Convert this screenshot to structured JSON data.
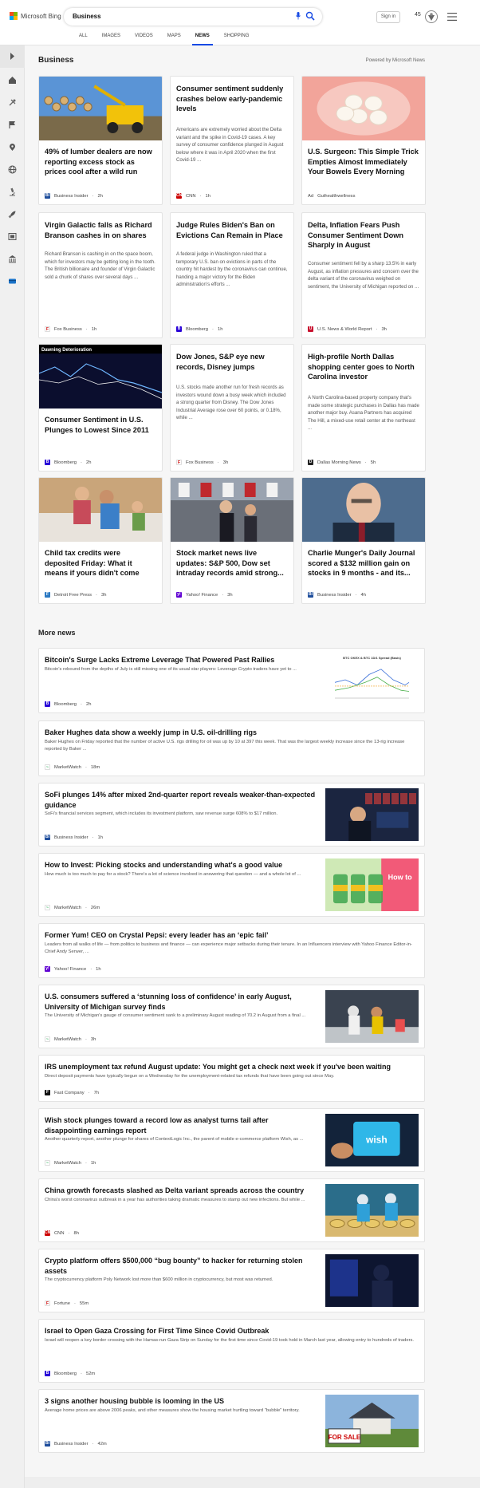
{
  "header": {
    "brand": "Microsoft Bing",
    "query": "Business",
    "signin": "Sign in",
    "points": "45",
    "tabs": [
      "ALL",
      "IMAGES",
      "VIDEOS",
      "MAPS",
      "NEWS",
      "SHOPPING"
    ],
    "active_tab": "NEWS"
  },
  "colors": {
    "accent": "#174ae4",
    "bing_red": "#f25022",
    "bing_green": "#7fba00",
    "bing_blue": "#00a4ef",
    "bing_yellow": "#ffb900"
  },
  "sidebar": {
    "icons": [
      "chevron-right-icon",
      "home-icon",
      "tools-icon",
      "flag-icon",
      "location-icon",
      "globe-icon",
      "microscope-icon",
      "rocket-icon",
      "film-icon",
      "bank-icon",
      "card-icon"
    ]
  },
  "section": {
    "title": "Business",
    "powered": "Powered by Microsoft News"
  },
  "cards": [
    {
      "title": "49% of lumber dealers are now reporting excess stock as prices cool after a wild run",
      "snippet": "",
      "source": "Business Insider",
      "age": "2h",
      "image": "lumber"
    },
    {
      "title": "Consumer sentiment suddenly crashes below early-pandemic levels",
      "snippet": "Americans are extremely worried about the Delta variant and the spike in Covid-19 cases. A key survey of consumer confidence plunged in August below where it was in April 2020 when the first Covid-19 ...",
      "source": "CNN",
      "age": "1h",
      "image": ""
    },
    {
      "title": "U.S. Surgeon: This Simple Trick Empties Almost Immediately Your Bowels Every Morning",
      "snippet": "",
      "source": "Guthealthwellness",
      "ad": "Ad",
      "age": "",
      "image": "eggs"
    },
    {
      "title": "Virgin Galactic falls as Richard Branson cashes in on shares",
      "snippet": "Richard Branson is cashing in on the space boom, which for investors may be getting long in the tooth. The British billionaire and founder of Virgin Galactic sold a chunk of shares over several days ...",
      "source": "Fox Business",
      "age": "1h",
      "image": ""
    },
    {
      "title": "Judge Rules Biden's Ban on Evictions Can Remain in Place",
      "snippet": "A federal judge in Washington ruled that a temporary U.S. ban on evictions in parts of the country hit hardest by the coronavirus can continue, handing a major victory for the Biden administration's efforts ...",
      "source": "Bloomberg",
      "age": "1h",
      "image": ""
    },
    {
      "title": "Delta, Inflation Fears Push Consumer Sentiment Down Sharply in August",
      "snippet": "Consumer sentiment fell by a sharp 13.5% in early August, as inflation pressures and concern over the delta variant of the coronavirus weighed on sentiment, the University of Michigan reported on ...",
      "source": "U.S. News & World Report",
      "age": "3h",
      "image": ""
    },
    {
      "title": "Consumer Sentiment in U.S. Plunges to Lowest Since 2011",
      "snippet": "",
      "source": "Bloomberg",
      "age": "2h",
      "image": "chart",
      "chart_text": "Dawning Deterioration"
    },
    {
      "title": "Dow Jones, S&P eye new records, Disney jumps",
      "snippet": "U.S. stocks made another run for fresh records as investors wound down a busy week which included a strong quarter from Disney. The Dow Jones Industrial Average rose over 60 points, or 0.18%, while ...",
      "source": "Fox Business",
      "age": "3h",
      "image": ""
    },
    {
      "title": "High-profile North Dallas shopping center goes to North Carolina investor",
      "snippet": "A North Carolina-based property company that's made some strategic purchases in Dallas has made another major buy. Asana Partners has acquired The Hill, a mixed-use retail center at the northeast ...",
      "source": "Dallas Morning News",
      "age": "5h",
      "image": ""
    },
    {
      "title": "Child tax credits were deposited Friday: What it means if yours didn't come",
      "snippet": "",
      "source": "Detroit Free Press",
      "age": "3h",
      "image": "family"
    },
    {
      "title": "Stock market news live updates: S&P 500, Dow set intraday records amid strong...",
      "snippet": "",
      "source": "Yahoo! Finance",
      "age": "3h",
      "image": "nyse"
    },
    {
      "title": "Charlie Munger's Daily Journal scored a $132 million gain on stocks in 9 months - and its...",
      "snippet": "",
      "source": "Business Insider",
      "age": "4h",
      "image": "munger"
    }
  ],
  "more_news": {
    "title": "More news",
    "items": [
      {
        "title": "Bitcoin's Surge Lacks Extreme Leverage That Powered Past Rallies",
        "snippet": "Bitcoin's rebound from the depths of July is still missing one of its usual star players: Leverage Crypto traders have yet to ...",
        "source": "Bloomberg",
        "age": "2h",
        "image": "btcchart",
        "img_caption": "BTC OKEX & BTC 1D/1 Spread (Basis)"
      },
      {
        "title": "Baker Hughes data show a weekly jump in U.S. oil-drilling rigs",
        "snippet": "Baker Hughes on Friday reported that the number of active U.S. rigs drilling for oil was up by 10 at 397 this week. That was the largest weekly increase since the 13-rig increase reported by Baker ...",
        "source": "MarketWatch",
        "age": "18m",
        "image": ""
      },
      {
        "title": "SoFi plunges 14% after mixed 2nd-quarter report reveals weaker-than-expected guidance",
        "snippet": "SoFi's financial services segment, which includes its investment platform, saw revenue surge 608% to $17 million.",
        "source": "Business Insider",
        "age": "1h",
        "image": "trader"
      },
      {
        "title": "How to Invest: Picking stocks and understanding what's a good value",
        "snippet": "How much is too much to pay for a stock? There's a lot of science involved in answering that question — and a whole lot of ...",
        "source": "MarketWatch",
        "age": "26m",
        "image": "invest",
        "img_caption": "How to know which stocks to buy"
      },
      {
        "title": "Former Yum! CEO on Crystal Pepsi: every leader has an ‘epic fail’",
        "snippet": "Leaders from all walks of life — from politics to business and finance — can experience major setbacks during their tenure. In an Influencers interview with Yahoo Finance Editor-in-Chief Andy Serwer, ...",
        "source": "Yahoo! Finance",
        "age": "1h",
        "image": ""
      },
      {
        "title": "U.S. consumers suffered a ‘stunning loss of confidence’ in early August, University of Michigan survey finds",
        "snippet": "The University of Michigan's gauge of consumer sentiment sank to a preliminary August reading of 70.2 in August from a final ...",
        "source": "MarketWatch",
        "age": "3h",
        "image": "shoppers"
      },
      {
        "title": "IRS unemployment tax refund August update: You might get a check next week if you've been waiting",
        "snippet": "Direct deposit payments have typically begun on a Wednesday for the unemployment-related tax refunds that have been going out since May.",
        "source": "Fast Company",
        "age": "7h",
        "image": ""
      },
      {
        "title": "Wish stock plunges toward a record low as analyst turns tail after disappointing earnings report",
        "snippet": "Another quarterly report, another plunge for shares of ContextLogic Inc., the parent of mobile e-commerce platform Wish, as ...",
        "source": "MarketWatch",
        "age": "1h",
        "image": "wish",
        "img_caption": "wish"
      },
      {
        "title": "China growth forecasts slashed as Delta variant spreads across the country",
        "snippet": "China's worst coronavirus outbreak in a year has authorities taking dramatic measures to stamp out new infections. But while ...",
        "source": "CNN",
        "age": "8h",
        "image": "ppe"
      },
      {
        "title": "Crypto platform offers $500,000 “bug bounty” to hacker for returning stolen assets",
        "snippet": "The cryptocurrency platform Poly Network lost more than $600 million in cryptocurrency, but most was returned.",
        "source": "Fortune",
        "age": "55m",
        "image": "hacker"
      },
      {
        "title": "Israel to Open Gaza Crossing for First Time Since Covid Outbreak",
        "snippet": "Israel will reopen a key border crossing with the Hamas-run Gaza Strip on Sunday for the first time since Covid-19 took hold in March last year, allowing entry to hundreds of traders.",
        "source": "Bloomberg",
        "age": "52m",
        "image": ""
      },
      {
        "title": "3 signs another housing bubble is looming in the US",
        "snippet": "Average home prices are above 2006 peaks, and other measures show the housing market hurtling toward \"bubble\" territory.",
        "source": "Business Insider",
        "age": "42m",
        "image": "house",
        "img_caption": "FOR SALE"
      }
    ]
  }
}
